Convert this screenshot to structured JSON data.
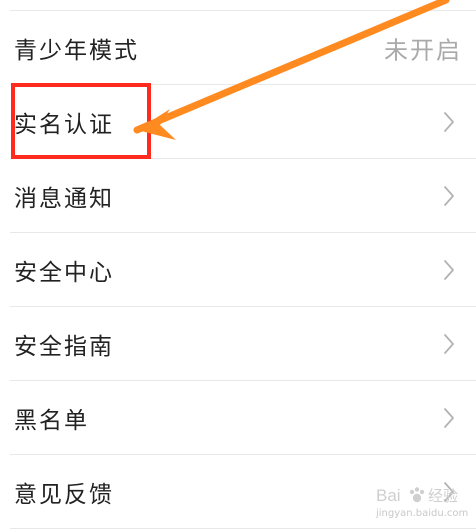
{
  "settings": {
    "items": [
      {
        "label": "青少年模式",
        "value": "未开启",
        "has_chevron": false
      },
      {
        "label": "实名认证",
        "has_chevron": true
      },
      {
        "label": "消息通知",
        "has_chevron": true
      },
      {
        "label": "安全中心",
        "has_chevron": true
      },
      {
        "label": "安全指南",
        "has_chevron": true
      },
      {
        "label": "黑名单",
        "has_chevron": true
      },
      {
        "label": "意见反馈",
        "has_chevron": true
      }
    ]
  },
  "annotation": {
    "highlight_color": "#ff2b1f",
    "arrow_color": "#ff8a1f"
  },
  "watermark": {
    "brand": "Bai经验",
    "url": "jingyan.baidu.com"
  }
}
